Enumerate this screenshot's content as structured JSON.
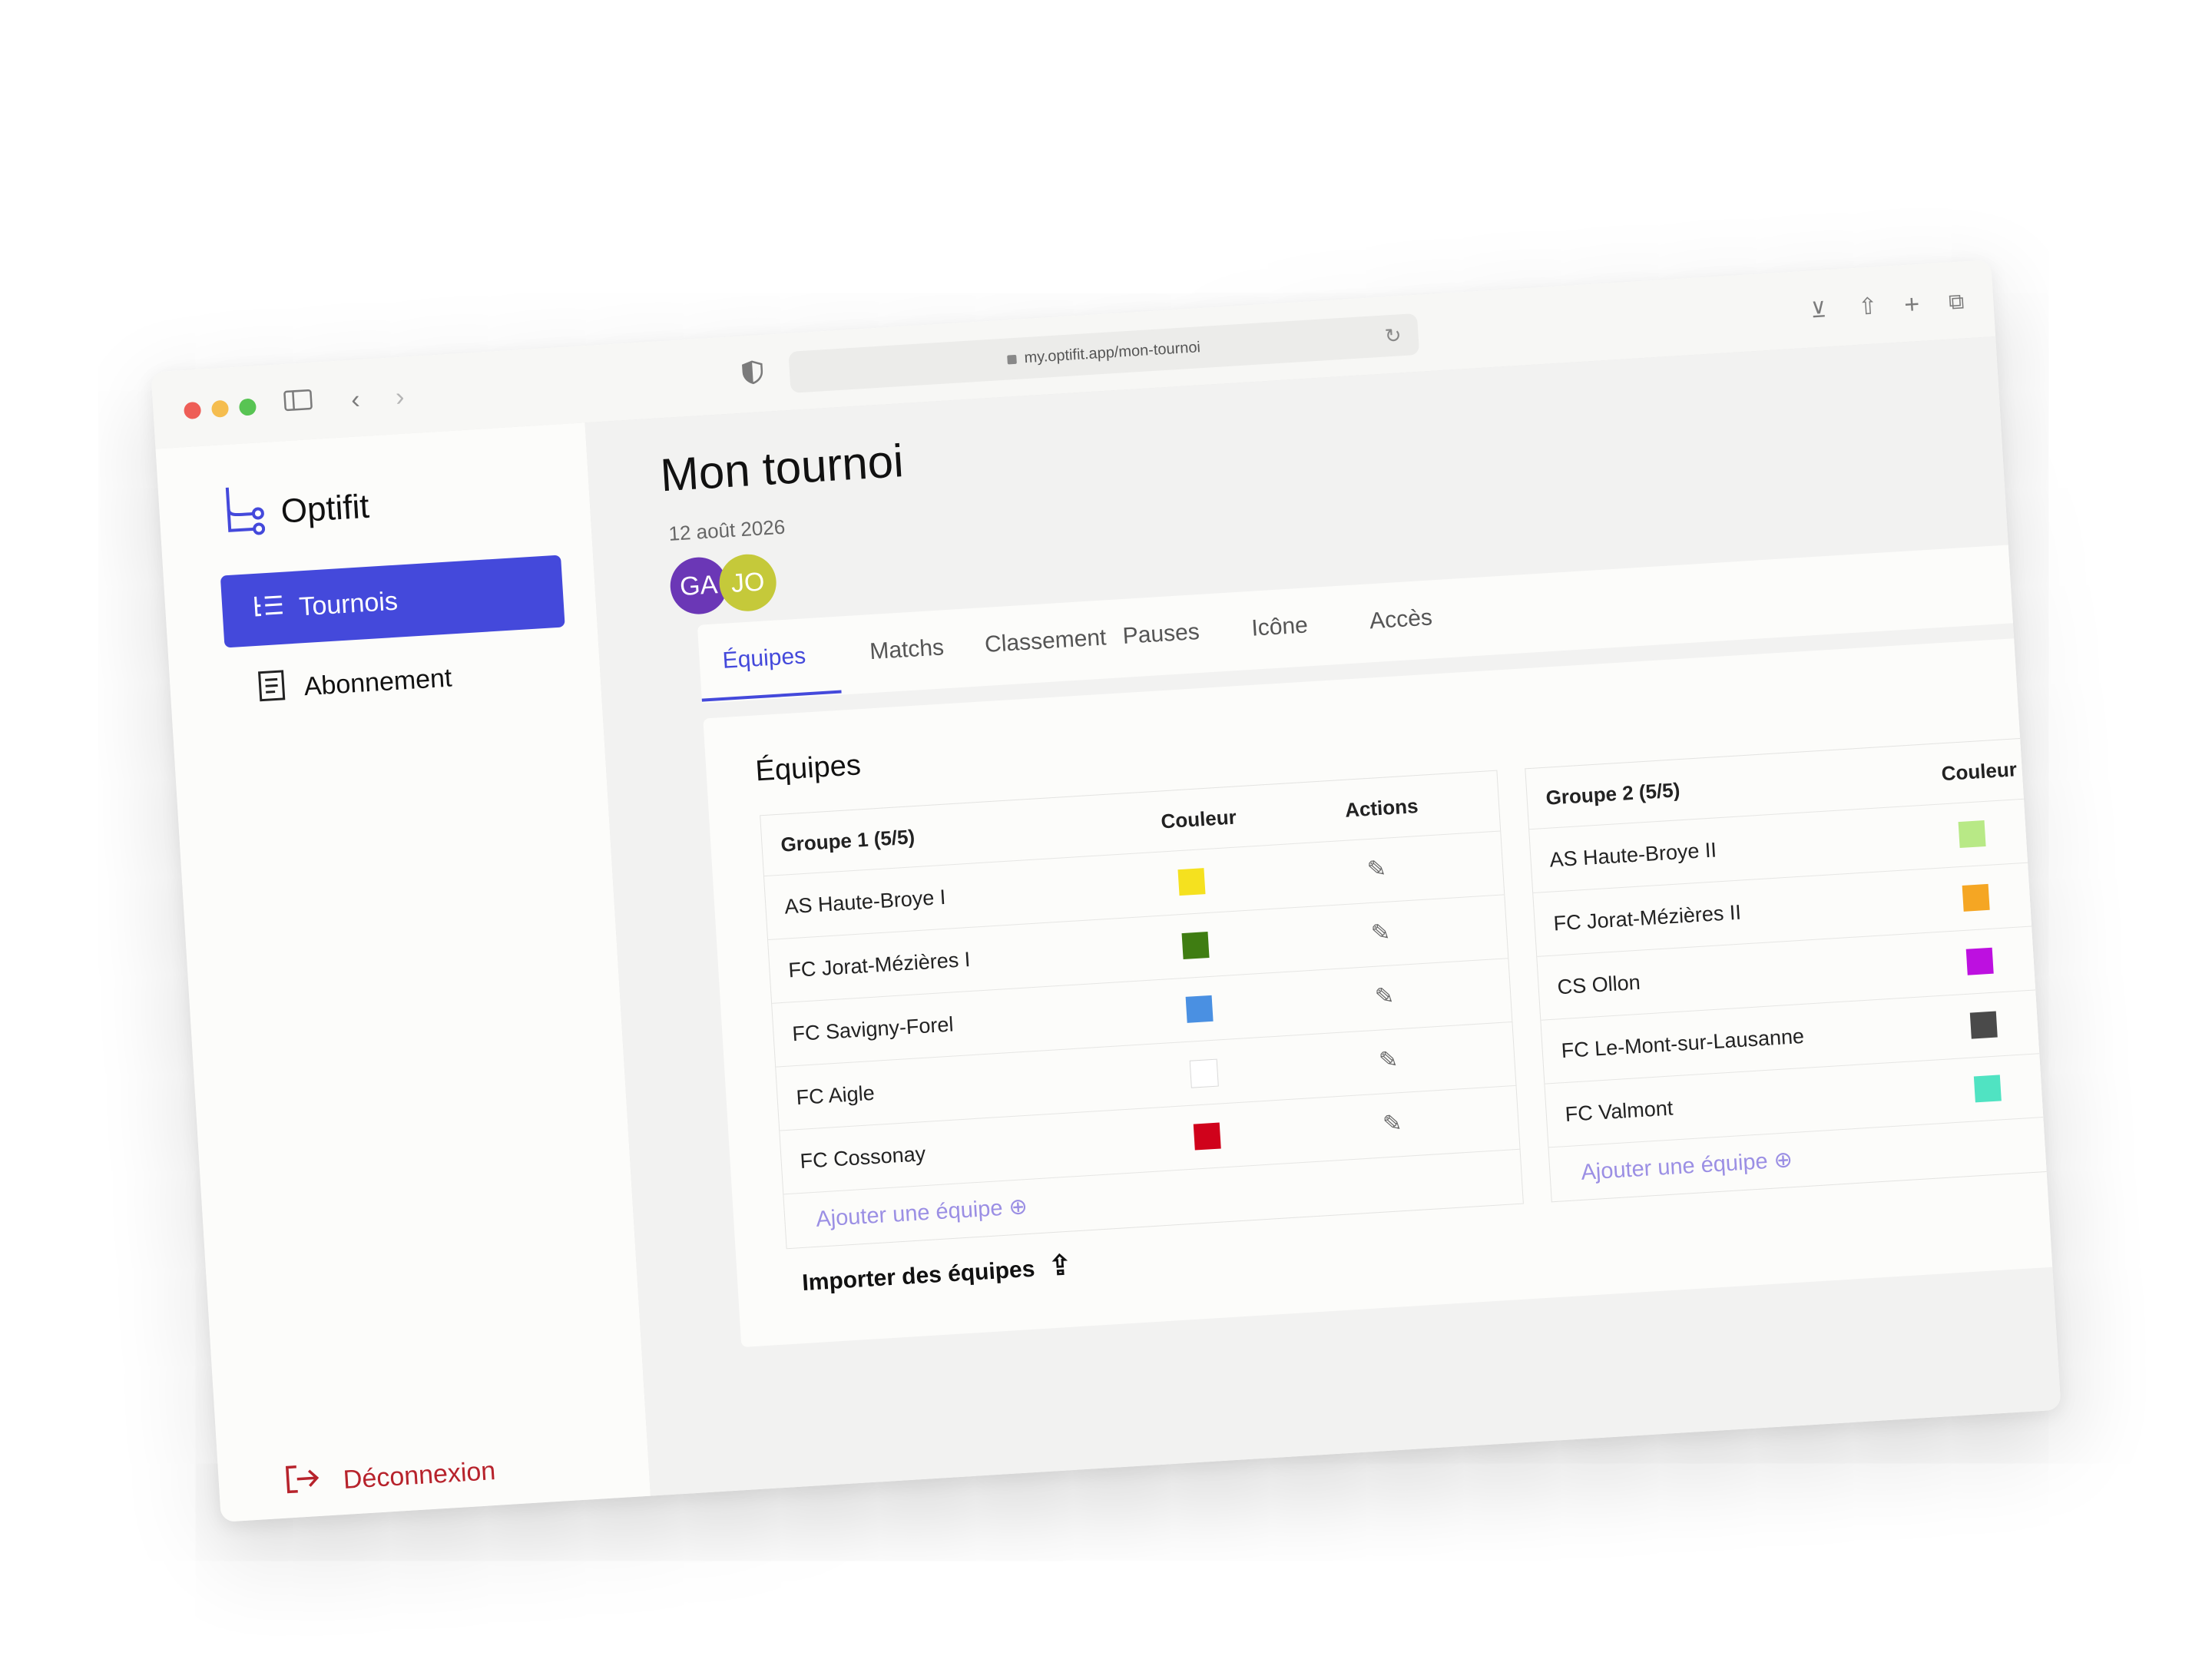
{
  "browser": {
    "url": "my.optifit.app/mon-tournoi",
    "icons": [
      "sidebar-toggle-icon",
      "back-icon",
      "forward-icon",
      "shield-icon",
      "reload-icon",
      "download-icon",
      "share-icon",
      "new-tab-icon",
      "tabs-overview-icon"
    ]
  },
  "sidebar": {
    "brand": "Optifit",
    "items": [
      {
        "label": "Tournois",
        "icon": "list-icon"
      },
      {
        "label": "Abonnement",
        "icon": "receipt-icon"
      }
    ],
    "logout": "Déconnexion"
  },
  "header": {
    "title": "Mon tournoi",
    "date": "12 août 2026",
    "avatars": [
      "GA",
      "JO"
    ]
  },
  "tabs": [
    "Équipes",
    "Matchs",
    "Classement",
    "Pauses",
    "Icône",
    "Accès"
  ],
  "card": {
    "title": "Équipes",
    "groups": [
      {
        "title": "Groupe 1 (5/5)",
        "col_color": "Couleur",
        "col_actions": "Actions",
        "teams": [
          {
            "name": "AS Haute-Broye I",
            "color": "#f5e11f"
          },
          {
            "name": "FC Jorat-Mézières I",
            "color": "#3f7d12"
          },
          {
            "name": "FC Savigny-Forel",
            "color": "#4a90e2"
          },
          {
            "name": "FC Aigle",
            "color": "#ffffff"
          },
          {
            "name": "FC Cossonay",
            "color": "#d0021b"
          }
        ],
        "add_label": "Ajouter une équipe"
      },
      {
        "title": "Groupe 2 (5/5)",
        "col_color": "Couleur",
        "teams": [
          {
            "name": "AS Haute-Broye II",
            "color": "#b8e986"
          },
          {
            "name": "FC Jorat-Mézières II",
            "color": "#f5a623"
          },
          {
            "name": "CS Ollon",
            "color": "#bd10e0"
          },
          {
            "name": "FC Le-Mont-sur-Lausanne",
            "color": "#4a4a4a"
          },
          {
            "name": "FC Valmont",
            "color": "#50e3c2"
          }
        ],
        "add_label": "Ajouter une équipe"
      }
    ],
    "import_label": "Importer des équipes"
  },
  "colors": {
    "accent": "#4449db",
    "logout": "#b7232c",
    "add_link": "#9b8fe4"
  }
}
